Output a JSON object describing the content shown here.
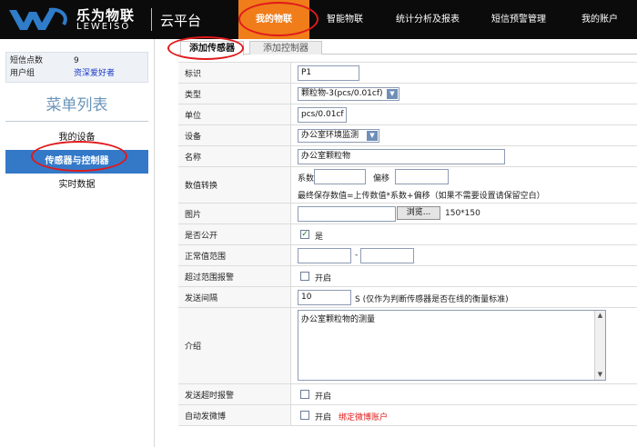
{
  "brand": {
    "name_cn": "乐为物联",
    "name_en": "LEWEISO",
    "platform": "云平台",
    "colors": {
      "topbar": "#0b0b0b",
      "active_nav": "#f07d1a",
      "accent_blue": "#3479c8",
      "highlight_ring": "#e0191b"
    }
  },
  "nav": {
    "items": [
      {
        "label": "我的物联",
        "active": true
      },
      {
        "label": "智能物联",
        "active": false
      },
      {
        "label": "统计分析及报表",
        "active": false
      },
      {
        "label": "短信预警管理",
        "active": false
      },
      {
        "label": "我的账户",
        "active": false
      }
    ]
  },
  "sidebar": {
    "stats": [
      {
        "label": "短信点数",
        "value": "9"
      },
      {
        "label": "用户组",
        "value": "资深爱好者"
      }
    ],
    "menu_title": "菜单列表",
    "menu": [
      {
        "label": "我的设备",
        "active": false
      },
      {
        "label": "传感器与控制器",
        "active": true
      },
      {
        "label": "实时数据",
        "active": false
      }
    ]
  },
  "tabs": [
    {
      "label": "添加传感器",
      "active": true
    },
    {
      "label": "添加控制器",
      "active": false
    }
  ],
  "form": {
    "id": {
      "label": "标识",
      "value": "P1"
    },
    "type": {
      "label": "类型",
      "selected": "颗粒物-3(pcs/0.01cf)"
    },
    "unit": {
      "label": "单位",
      "value": "pcs/0.01cf"
    },
    "device": {
      "label": "设备",
      "selected": "办公室环境监测"
    },
    "name": {
      "label": "名称",
      "value": "办公室颗粒物"
    },
    "conversion": {
      "label": "数值转换",
      "coef_label": "系数",
      "coef_value": "",
      "offset_label": "偏移",
      "offset_value": "",
      "hint": "最终保存数值=上传数值*系数+偏移（如果不需要设置请保留空白）"
    },
    "image": {
      "label": "图片",
      "value": "",
      "browse_label": "浏览...",
      "size_hint": "150*150"
    },
    "public": {
      "label": "是否公开",
      "checked": true,
      "option_label": "是"
    },
    "range": {
      "label": "正常值范围",
      "min": "",
      "separator": "-",
      "max": ""
    },
    "range_alarm": {
      "label": "超过范围报警",
      "checked": false,
      "option_label": "开启"
    },
    "interval": {
      "label": "发送间隔",
      "value": "10",
      "hint": "S (仅作为判断传感器是否在线的衡量标准)"
    },
    "intro": {
      "label": "介绍",
      "value": "办公室颗粒物的测量"
    },
    "timeout_alarm": {
      "label": "发送超时报警",
      "checked": false,
      "option_label": "开启"
    },
    "auto_weibo": {
      "label": "自动发微博",
      "checked": false,
      "option_label": "开启",
      "link_label": "绑定微博账户"
    }
  }
}
